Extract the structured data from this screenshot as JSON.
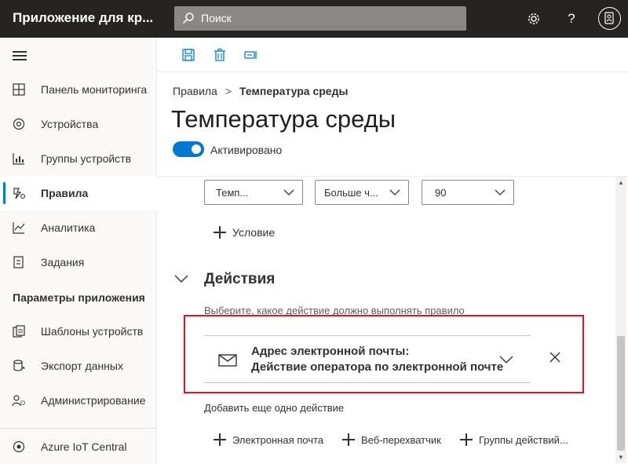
{
  "header": {
    "app_title": "Приложение для кр...",
    "search_placeholder": "Поиск",
    "icons": [
      "search-icon",
      "gear-icon",
      "help-icon",
      "avatar-icon"
    ]
  },
  "sidebar": {
    "items": [
      {
        "label": "Панель мониторинга",
        "icon": "dashboard-icon"
      },
      {
        "label": "Устройства",
        "icon": "devices-icon"
      },
      {
        "label": "Группы устройств",
        "icon": "device-groups-icon"
      },
      {
        "label": "Правила",
        "icon": "rules-icon",
        "active": true
      },
      {
        "label": "Аналитика",
        "icon": "analytics-icon"
      },
      {
        "label": "Задания",
        "icon": "jobs-icon"
      }
    ],
    "section_label": "Параметры приложения",
    "settings_items": [
      {
        "label": "Шаблоны устройств",
        "icon": "device-templates-icon"
      },
      {
        "label": "Экспорт данных",
        "icon": "data-export-icon"
      },
      {
        "label": "Администрирование",
        "icon": "administration-icon"
      }
    ],
    "footer_item": {
      "label": "Azure IoT Central",
      "icon": "iot-central-icon"
    }
  },
  "toolbar": {
    "icons": [
      "save-icon",
      "delete-icon",
      "toggle-rule-icon"
    ]
  },
  "breadcrumb": {
    "parent": "Правила",
    "separator": ">",
    "current": "Температура среды"
  },
  "page": {
    "title": "Температура среды",
    "toggle_label": "Активировано",
    "toggle_on": true
  },
  "condition": {
    "telemetry": "Темп...",
    "operator": "Больше ч...",
    "value": "90",
    "add_condition_label": "Условие"
  },
  "actions": {
    "section_title": "Действия",
    "help_text": "Выберите, какое действие должно выполнять правило",
    "card": {
      "line1": "Адрес электронной почты:",
      "line2": "Действие оператора по электронной почте",
      "icon": "mail-icon"
    },
    "add_another_label": "Добавить еще одно действие",
    "add_buttons": [
      "Электронная почта",
      "Веб-перехватчик",
      "Группы действий..."
    ]
  },
  "colors": {
    "header_bg": "#252423",
    "accent": "#0078d4",
    "highlight": "#e81123"
  }
}
